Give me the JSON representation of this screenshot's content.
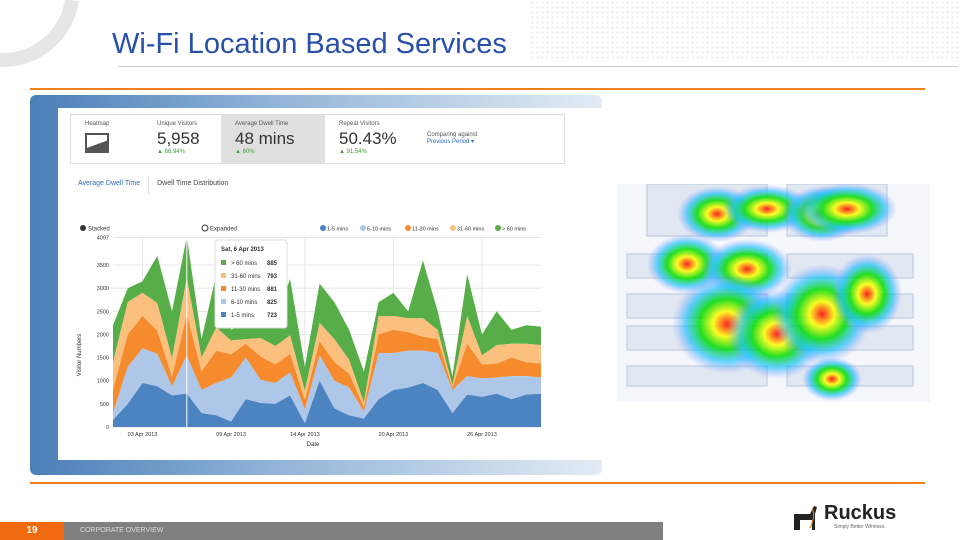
{
  "slide": {
    "title": "Wi-Fi Location Based Services",
    "page_number": "19",
    "footer": "CORPORATE OVERVIEW",
    "logo": "Ruckus",
    "tagline": "Simply Better Wireless."
  },
  "kpis": [
    {
      "label": "Heatmap"
    },
    {
      "label": "Unique Visitors",
      "value": "5,958",
      "delta": "▲ 66.94%"
    },
    {
      "label": "Average Dwell Time",
      "value": "48 mins",
      "delta": "▲ 60%"
    },
    {
      "label": "Repeat Visitors",
      "value": "50.43%",
      "delta": "▲ 91.54%"
    },
    {
      "label": "Comparing against",
      "link": "Previous Period ▾"
    }
  ],
  "tabs": [
    "Average Dwell Time",
    "Dwell Time Distribution"
  ],
  "modes": [
    "Stacked",
    "Expanded"
  ],
  "tooltip": {
    "title": "Sat, 6 Apr 2013",
    "rows": [
      [
        "> 60 mins",
        "885"
      ],
      [
        "31-60 mins",
        "793"
      ],
      [
        "11-30 mins",
        "881"
      ],
      [
        "6-10 mins",
        "825"
      ],
      [
        "1-5 mins",
        "723"
      ]
    ]
  },
  "colors": {
    "s1": "#4b84c0",
    "s2": "#aec7e8",
    "s3": "#f58b2c",
    "s4": "#fbbf7e",
    "s5": "#57ad47"
  },
  "chart_data": {
    "type": "area",
    "stacked": true,
    "xlabel": "Date",
    "ylabel": "Visitor Numbers",
    "ylim": [
      0,
      4107
    ],
    "yticks": [
      "0",
      "500",
      "1000",
      "1500",
      "2000",
      "2500",
      "3000",
      "3500",
      "4097"
    ],
    "xticks": [
      {
        "day": 3,
        "label": "03 Apr 2013"
      },
      {
        "day": 9,
        "label": "09 Apr 2013"
      },
      {
        "day": 14,
        "label": "14 Apr 2013"
      },
      {
        "day": 20,
        "label": "20 Apr 2013"
      },
      {
        "day": 26,
        "label": "26 Apr 2013"
      }
    ],
    "days": [
      1,
      2,
      3,
      4,
      5,
      6,
      7,
      8,
      9,
      10,
      11,
      12,
      13,
      14,
      15,
      16,
      17,
      18,
      19,
      20,
      21,
      22,
      23,
      24,
      25,
      26,
      27,
      28,
      29,
      30
    ],
    "series": [
      {
        "name": "1-5 mins",
        "values": [
          150,
          500,
          950,
          880,
          680,
          723,
          300,
          250,
          120,
          600,
          520,
          500,
          680,
          80,
          1000,
          400,
          250,
          180,
          600,
          800,
          850,
          950,
          800,
          300,
          700,
          650,
          720,
          600,
          700,
          720
        ]
      },
      {
        "name": "6-10 mins",
        "values": [
          150,
          800,
          750,
          700,
          200,
          825,
          500,
          700,
          950,
          900,
          500,
          450,
          500,
          300,
          550,
          600,
          600,
          150,
          1000,
          800,
          800,
          700,
          800,
          500,
          400,
          400,
          350,
          500,
          400,
          350
        ]
      },
      {
        "name": "11-30 mins",
        "values": [
          500,
          700,
          700,
          500,
          200,
          881,
          400,
          700,
          500,
          300,
          500,
          400,
          400,
          200,
          300,
          400,
          300,
          100,
          400,
          500,
          400,
          300,
          300,
          50,
          700,
          300,
          300,
          400,
          300,
          300
        ]
      },
      {
        "name": "31-60 mins",
        "values": [
          600,
          700,
          500,
          600,
          400,
          793,
          300,
          500,
          300,
          100,
          400,
          400,
          400,
          200,
          400,
          500,
          300,
          100,
          400,
          300,
          300,
          400,
          200,
          50,
          600,
          200,
          400,
          300,
          400,
          400
        ]
      },
      {
        "name": "> 60 mins",
        "values": [
          800,
          300,
          250,
          1020,
          1020,
          885,
          400,
          1150,
          230,
          400,
          480,
          600,
          1220,
          520,
          850,
          800,
          650,
          670,
          300,
          500,
          150,
          1250,
          400,
          200,
          900,
          450,
          730,
          300,
          400,
          400
        ]
      }
    ]
  }
}
